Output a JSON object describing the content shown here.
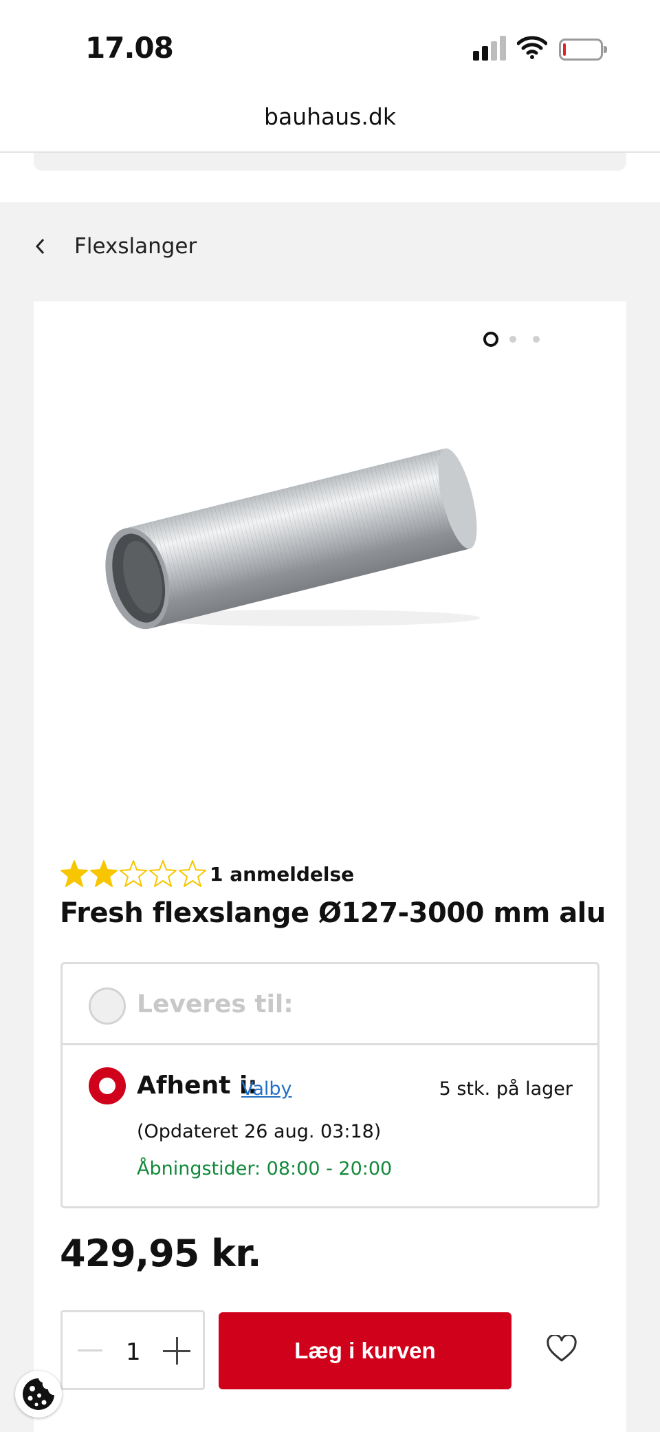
{
  "status_bar": {
    "time": "17.08",
    "icons": [
      "cellular-signal-icon",
      "wifi-icon",
      "battery-low-icon"
    ],
    "battery_color": "#e0242a"
  },
  "browser": {
    "url": "bauhaus.dk"
  },
  "breadcrumb": {
    "back_icon": "chevron-left-icon",
    "label": "Flexslanger"
  },
  "gallery": {
    "image_count": 3,
    "active_index": 0,
    "image_subject": "aluminium flex duct"
  },
  "product": {
    "rating": 2,
    "rating_max": 5,
    "reviews": "1 anmeldelse",
    "title": "Fresh flexslange Ø127-3000 mm alu",
    "price": "429,95 kr.",
    "star_color": "#f7c600"
  },
  "delivery": {
    "home_delivery_label": "Leveres til:",
    "home_delivery_selected": false,
    "pickup_label": "Afhent i:",
    "pickup_selected": true,
    "store": "Valby",
    "stock": "5 stk. på lager",
    "updated": "(Opdateret 26 aug. 03:18)",
    "opening_hours": "Åbningstider: 08:00 - 20:00"
  },
  "cart": {
    "quantity": "1",
    "add_to_cart_label": "Læg i kurven",
    "wishlist_icon": "heart-icon",
    "brand_color": "#d0021b"
  },
  "cookie": {
    "icon": "cookie-icon"
  }
}
